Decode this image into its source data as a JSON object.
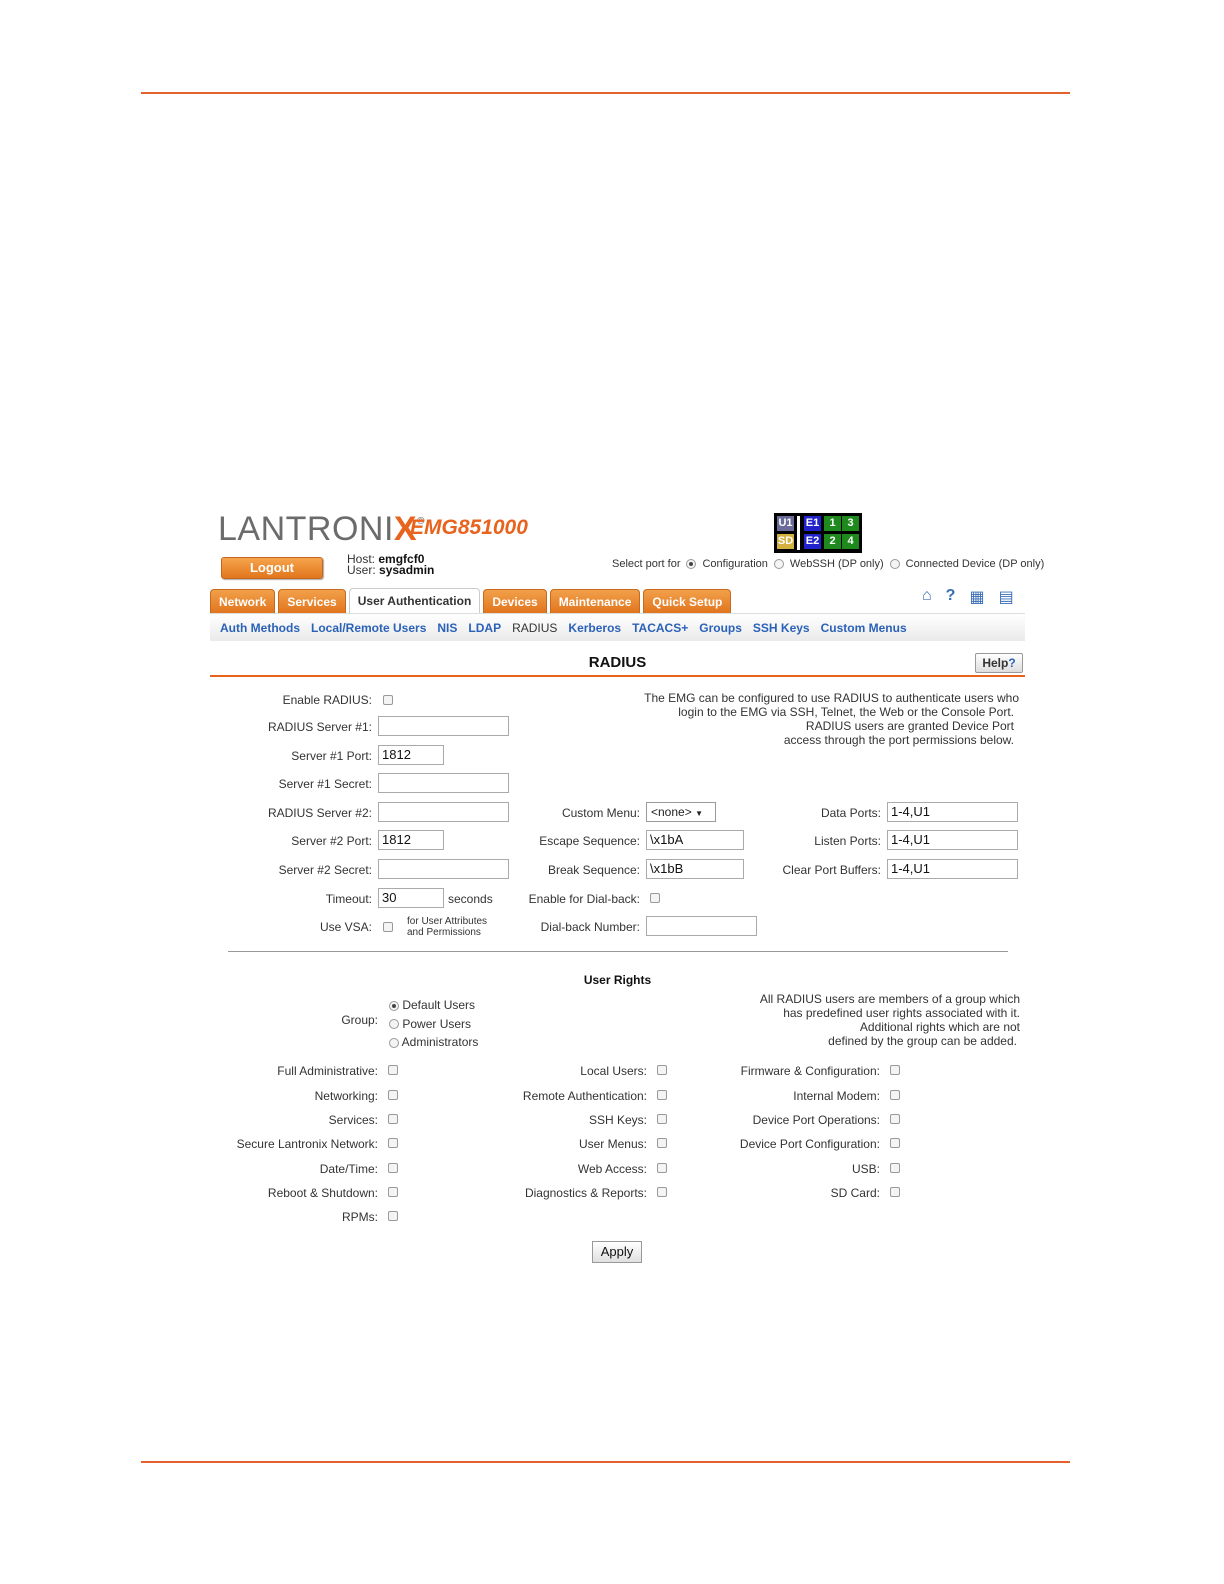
{
  "brand": {
    "logo_text": "LANTRONIX",
    "model": "EMG851000"
  },
  "header": {
    "logout_label": "Logout",
    "host_label": "Host:",
    "host_value": "emgfcf0",
    "user_label": "User:",
    "user_value": "sysadmin",
    "ports": [
      {
        "label": "U1",
        "color": "#6b6b9a"
      },
      {
        "label": "E1",
        "color": "#2222cc"
      },
      {
        "label": "1",
        "color": "#1e8a1e"
      },
      {
        "label": "3",
        "color": "#1e8a1e"
      },
      {
        "label": "SD",
        "color": "#d4b040"
      },
      {
        "label": "E2",
        "color": "#2222cc"
      },
      {
        "label": "2",
        "color": "#1e8a1e"
      },
      {
        "label": "4",
        "color": "#1e8a1e"
      }
    ],
    "select_port_label": "Select port for",
    "port_options": [
      "Configuration",
      "WebSSH (DP only)",
      "Connected Device (DP only)"
    ],
    "selected_port_option": "Configuration"
  },
  "tabs": [
    "Network",
    "Services",
    "User Authentication",
    "Devices",
    "Maintenance",
    "Quick Setup"
  ],
  "active_tab": "User Authentication",
  "toolbar_icons": [
    "home-icon",
    "help-icon",
    "sitemap-icon",
    "log-icon"
  ],
  "subnav": [
    "Auth Methods",
    "Local/Remote Users",
    "NIS",
    "LDAP",
    "RADIUS",
    "Kerberos",
    "TACACS+",
    "Groups",
    "SSH Keys",
    "Custom Menus"
  ],
  "active_subnav": "RADIUS",
  "page": {
    "title": "RADIUS",
    "help_label": "Help"
  },
  "form": {
    "enable_radius_label": "Enable RADIUS:",
    "server1_label": "RADIUS Server #1:",
    "server1_value": "",
    "port1_label": "Server #1 Port:",
    "port1_value": "1812",
    "secret1_label": "Server #1 Secret:",
    "server2_label": "RADIUS Server #2:",
    "server2_value": "",
    "port2_label": "Server #2 Port:",
    "port2_value": "1812",
    "secret2_label": "Server #2 Secret:",
    "timeout_label": "Timeout:",
    "timeout_value": "30",
    "timeout_unit": "seconds",
    "use_vsa_label": "Use VSA:",
    "vsa_note_1": "for User Attributes",
    "vsa_note_2": "and Permissions",
    "info_lines": [
      "The EMG can be configured to use RADIUS to authenticate users who",
      "login to the EMG via SSH, Telnet, the Web or the Console Port.",
      "RADIUS users are granted Device Port",
      "access through the port permissions below."
    ],
    "custom_menu_label": "Custom Menu:",
    "custom_menu_value": "<none>",
    "escape_label": "Escape Sequence:",
    "escape_value": "\\x1bA",
    "break_label": "Break Sequence:",
    "break_value": "\\x1bB",
    "dialback_label": "Enable for Dial-back:",
    "dialback_number_label": "Dial-back Number:",
    "dialback_number_value": "",
    "data_ports_label": "Data Ports:",
    "data_ports_value": "1-4,U1",
    "listen_ports_label": "Listen Ports:",
    "listen_ports_value": "1-4,U1",
    "clear_buffers_label": "Clear Port Buffers:",
    "clear_buffers_value": "1-4,U1"
  },
  "user_rights": {
    "title": "User Rights",
    "group_label": "Group:",
    "groups": [
      "Default Users",
      "Power Users",
      "Administrators"
    ],
    "selected_group": "Default Users",
    "group_note": [
      "All RADIUS users are members of a group which",
      "has predefined user rights associated with it.",
      "Additional rights which are not",
      "defined by the group can be added."
    ],
    "col1": [
      "Full Administrative:",
      "Networking:",
      "Services:",
      "Secure Lantronix Network:",
      "Date/Time:",
      "Reboot & Shutdown:",
      "RPMs:"
    ],
    "col2": [
      "Local Users:",
      "Remote Authentication:",
      "SSH Keys:",
      "User Menus:",
      "Web Access:",
      "Diagnostics & Reports:"
    ],
    "col3": [
      "Firmware & Configuration:",
      "Internal Modem:",
      "Device Port Operations:",
      "Device Port Configuration:",
      "USB:",
      "SD Card:"
    ]
  },
  "apply_label": "Apply"
}
